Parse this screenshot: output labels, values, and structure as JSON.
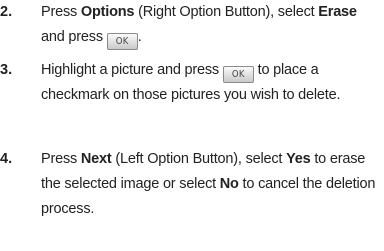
{
  "steps": [
    {
      "num": "2.",
      "parts": [
        {
          "t": "Press "
        },
        {
          "b": "Options"
        },
        {
          "t": " (Right Option Button), select "
        },
        {
          "b": "Erase"
        },
        {
          "t": " and press "
        },
        {
          "key": "OK"
        },
        {
          "t": "."
        }
      ]
    },
    {
      "num": "3.",
      "parts": [
        {
          "t": "Highlight a picture and press "
        },
        {
          "key": "OK"
        },
        {
          "t": " to place a checkmark on those pictures you wish to delete."
        }
      ]
    },
    {
      "num": "4.",
      "parts": [
        {
          "t": "Press "
        },
        {
          "b": "Next"
        },
        {
          "t": " (Left Option Button), select "
        },
        {
          "b": "Yes"
        },
        {
          "t": " to erase the selected image or select "
        },
        {
          "b": "No"
        },
        {
          "t": " to cancel the deletion process."
        }
      ]
    }
  ]
}
